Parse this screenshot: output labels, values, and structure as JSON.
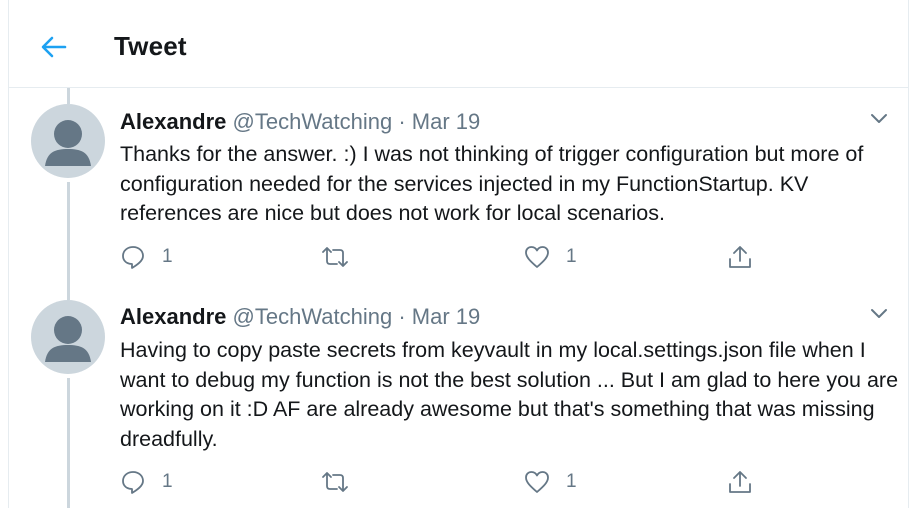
{
  "header": {
    "title": "Tweet",
    "back_icon": "arrow-left-icon",
    "accent_color": "#1da1f2"
  },
  "tweets": [
    {
      "author_name": "Alexandre",
      "author_handle": "@TechWatching",
      "separator": "·",
      "date": "Mar 19",
      "text": "Thanks for the answer. :) I was not thinking of trigger configuration but more of configuration needed for the services injected in my FunctionStartup. KV references are nice but does not work for local scenarios.",
      "reply_count": "1",
      "retweet_count": "",
      "like_count": "1"
    },
    {
      "author_name": "Alexandre",
      "author_handle": "@TechWatching",
      "separator": "·",
      "date": "Mar 19",
      "text": "Having to copy paste secrets from keyvault in my local.settings.json file when I want to debug my function is not the best solution ... But I am glad to here you are working on it :D AF are already awesome but that's something that was missing dreadfully.",
      "reply_count": "1",
      "retweet_count": "",
      "like_count": "1"
    }
  ],
  "icons": {
    "reply": "reply-icon",
    "retweet": "retweet-icon",
    "like": "heart-icon",
    "share": "share-icon",
    "more": "chevron-down-icon",
    "avatar": "default-avatar-icon"
  },
  "colors": {
    "text_primary": "#14171a",
    "text_secondary": "#657786",
    "divider": "#e6ecf0",
    "thread_line": "#ccd6dd"
  }
}
